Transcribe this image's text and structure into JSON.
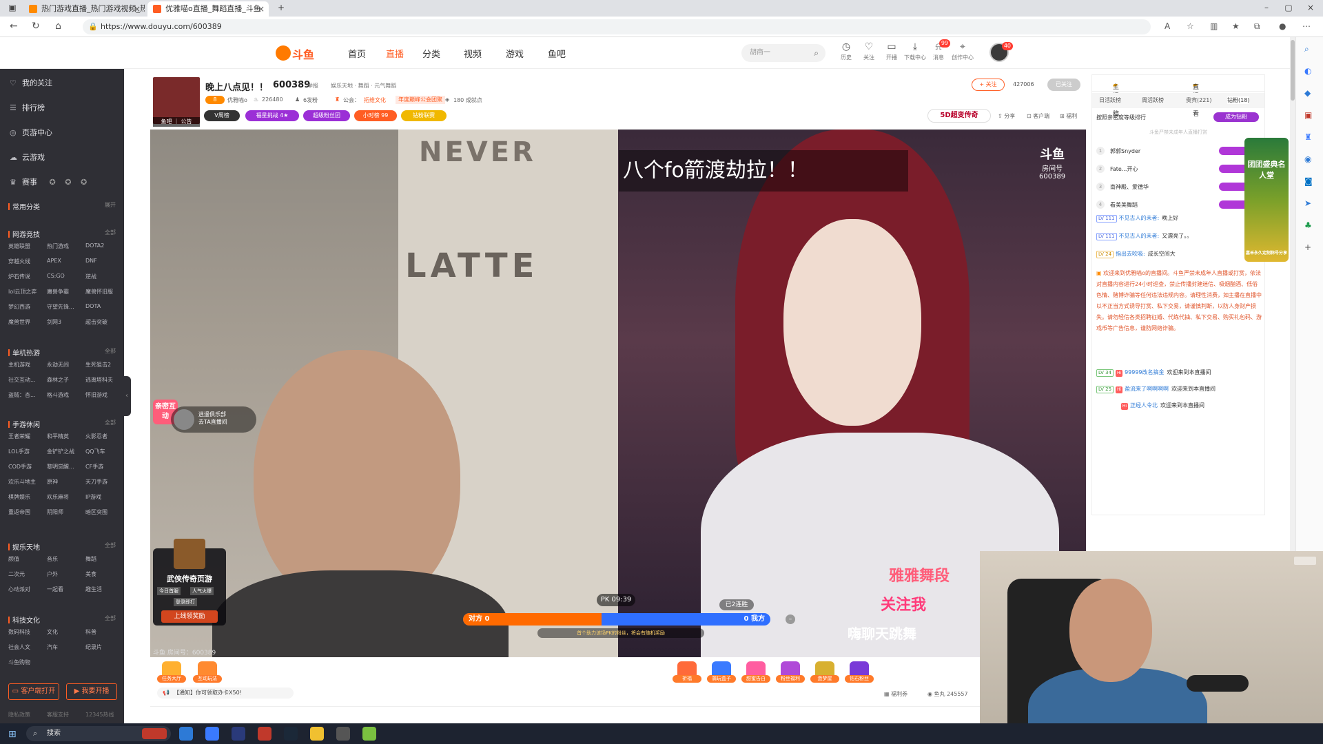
{
  "browser": {
    "tabs": [
      {
        "title": "热门游戏直播_热门游戏视频_热"
      },
      {
        "title": "优雅喵o直播_舞蹈直播_斗鱼"
      }
    ],
    "url": "https://www.douyu.com/600389"
  },
  "site": {
    "logo_text": "斗鱼",
    "nav": [
      "首页",
      "直播",
      "分类",
      "视频",
      "游戏",
      "鱼吧"
    ],
    "search_placeholder": "胡商一",
    "header_icons": [
      {
        "label": "历史",
        "icon": "history-icon"
      },
      {
        "label": "关注",
        "icon": "heart-icon"
      },
      {
        "label": "开播",
        "icon": "camera-icon"
      },
      {
        "label": "下载中心",
        "icon": "download-icon"
      },
      {
        "label": "消息",
        "icon": "bell-icon",
        "badge": "99"
      },
      {
        "label": "创作中心",
        "icon": "location-icon"
      }
    ],
    "avatar_badge": "40"
  },
  "sidebar": {
    "top": [
      {
        "label": "我的关注",
        "icon": "heart-icon"
      },
      {
        "label": "排行榜",
        "icon": "rank-icon"
      },
      {
        "label": "页游中心",
        "icon": "game-icon"
      },
      {
        "label": "云游戏",
        "icon": "cloud-icon"
      },
      {
        "label": "赛事",
        "icon": "trophy-icon"
      }
    ],
    "common_label": "常用分类",
    "expand": "展开",
    "more": "全部",
    "sections": [
      {
        "title": "网游竞技",
        "items": [
          "英雄联盟",
          "热门游戏",
          "DOTA2",
          "穿越火线",
          "APEX",
          "DNF",
          "炉石传说",
          "CS:GO",
          "逆战",
          "lol云顶之弈",
          "魔兽争霸",
          "魔兽怀旧服",
          "梦幻西游",
          "守望先锋...",
          "DOTA",
          "魔兽世界",
          "剑网3",
          "超击突破"
        ]
      },
      {
        "title": "单机热游",
        "items": [
          "主机游戏",
          "永劫无间",
          "生死狙击2",
          "社交互动...",
          "森林之子",
          "逃离塔科夫",
          "盗贼：杏...",
          "格斗游戏",
          "怀旧游戏"
        ]
      },
      {
        "title": "手游休闲",
        "items": [
          "王者荣耀",
          "和平精英",
          "火影忍者",
          "LOL手游",
          "金铲铲之战",
          "QQ飞车",
          "COD手游",
          "黎明觉醒...",
          "CF手游",
          "欢乐斗地主",
          "原神",
          "天刀手游",
          "棋牌娱乐",
          "欢乐麻将",
          "IP游戏",
          "重返帝国",
          "阴阳师",
          "暗区突围"
        ]
      },
      {
        "title": "娱乐天地",
        "items": [
          "颜值",
          "音乐",
          "舞蹈",
          "二次元",
          "户外",
          "美食",
          "心动派对",
          "一起看",
          "趣生活"
        ]
      },
      {
        "title": "科技文化",
        "items": [
          "数码科技",
          "文化",
          "科普",
          "社会人文",
          "汽车",
          "纪录片",
          "斗鱼购物"
        ]
      }
    ],
    "btn_client": "客户端打开",
    "btn_live": "我要开播",
    "footer": [
      "隐私政策",
      "客服支持",
      "12345热线"
    ]
  },
  "room": {
    "title": "晚上八点见！！",
    "id": "600389",
    "report": "举报",
    "crumbs": "娱乐天地 · 舞蹈 · 元气舞蹈",
    "level": "8",
    "streamer": "优雅喵o",
    "hot": "226480",
    "fans_count": "6发粉",
    "guild_label": "公会：",
    "guild_name": "拓维文化",
    "guild_tag": "年度巅峰公会团聚",
    "reports": "180 成就点",
    "av_tag": "鱼吧 ｜ 公告",
    "chips": [
      {
        "label": "V周榜",
        "color": "#333"
      },
      {
        "label": "福星挑战 4★",
        "color": "#9b2fd6"
      },
      {
        "label": "超级粉丝团",
        "color": "#9b2fd6"
      },
      {
        "label": "小时榜 99",
        "color": "#ff5d23"
      },
      {
        "label": "钻粉联赛",
        "color": "#f0b800"
      }
    ],
    "follow": "+ 关注",
    "follow_count": "427006",
    "followed": "已关注",
    "game_ad": "5D超变传奇",
    "tools": [
      "分享",
      "客户端",
      "福利"
    ]
  },
  "video": {
    "caption": "八个fo箭渡劫拉！！",
    "watermark": "斗鱼",
    "watermark_sub": "房间号",
    "watermark_id": "600389",
    "left_sign1": "NEVER",
    "left_sign2": "LATTE",
    "right_text1": "雅雅舞段",
    "right_text2": "关注我",
    "right_text3": "嗨聊天跳舞",
    "interact_tag": "亲密互动",
    "guest_name": "逍遥俱乐部",
    "guest_sub": "去TA直播间",
    "game_card_name": "武侠传奇页游",
    "game_card_tags": [
      "今日首服",
      "人气火爆",
      "登录即打"
    ],
    "game_card_btn": "上线领奖励",
    "pk_timer": "PK 09:39",
    "pk_streak": "已2连胜",
    "pk_opponent": "对方 0",
    "pk_self": "0 我方",
    "pk_opp_share": 0.45,
    "pk_tip": "首个助力该场PK的粉丝，将会有随机奖励",
    "room_id_text": "斗鱼 房间号：600389"
  },
  "gifts": {
    "left": [
      {
        "label": "任务大厅",
        "color": "#ffb030"
      },
      {
        "label": "互动玩法",
        "color": "#ff8a30"
      }
    ],
    "right": [
      {
        "label": "祈福",
        "color": "#ff6a3a"
      },
      {
        "label": "蒲玩盒子",
        "color": "#3a7aff"
      },
      {
        "label": "甜蜜告白",
        "color": "#ff5da0"
      },
      {
        "label": "粉丝福利",
        "color": "#b04ad8"
      },
      {
        "label": "造梦屋",
        "color": "#d8b030"
      },
      {
        "label": "钻石粉丝",
        "color": "#7a3ad8"
      }
    ],
    "notice": "【通知】你可领取办卡X50!",
    "welfare": "福利券",
    "fish_balls": "鱼丸 245557"
  },
  "chat": {
    "tabs1": [
      "主播投稿",
      "直播回看"
    ],
    "tabs2": [
      "日活跃榜",
      "周活跃榜",
      "贵宾(221)",
      "钻粉(18)"
    ],
    "rank_head": "按照亲密度等级排行",
    "rank_btn": "成为钻粉",
    "rank_note": "斗鱼严禁未成年人直播打赏",
    "rank": [
      {
        "no": "1",
        "name": "郭郭Snyder"
      },
      {
        "no": "2",
        "name": "Fate...开心"
      },
      {
        "no": "3",
        "name": "南神殿、爱德华"
      },
      {
        "no": "4",
        "name": "看美美舞蹈"
      }
    ],
    "messages": [
      {
        "lv": "LV 111",
        "user": "不见古人的未者:",
        "text": "晚上好"
      },
      {
        "lv": "LV 111",
        "user": "不见古人的未者:",
        "text": "又漂亮了。。"
      },
      {
        "lv": "LV 24",
        "user": "指出去吹吸:",
        "text": "成长空间大"
      }
    ],
    "system": "欢迎来到优雅喵o的直播间。斗鱼严禁未成年人直播或打赏，依法对直播内容进行24小时巡查，禁止传播封建迷信、吸烟酗酒、低俗色情、赌博诈骗等任何违法违规内容。请理性消费，如主播在直播中以不正当方式诱导打赏、私下交易，请谨慎判断，以防人身财产损失。请勿轻信各类招聘征婚、代练代抽、私下交易、购买礼包码、游戏币等广告信息，谨防网络诈骗。",
    "welcome": [
      {
        "lv": "LV 34",
        "user": "99999改名搞金",
        "text": "欢迎来到本直播间"
      },
      {
        "lv": "LV 25",
        "user": "盈流来了啊啊啊啊",
        "text": "欢迎来到本直播间"
      },
      {
        "lv": "",
        "user": "正经人令北",
        "text": "欢迎来到本直播间"
      }
    ],
    "fame_banner": "团团盛典名人堂",
    "fame_sub": "嘉禾永久定制称号分享"
  },
  "taskbar": {
    "search": "搜索"
  }
}
